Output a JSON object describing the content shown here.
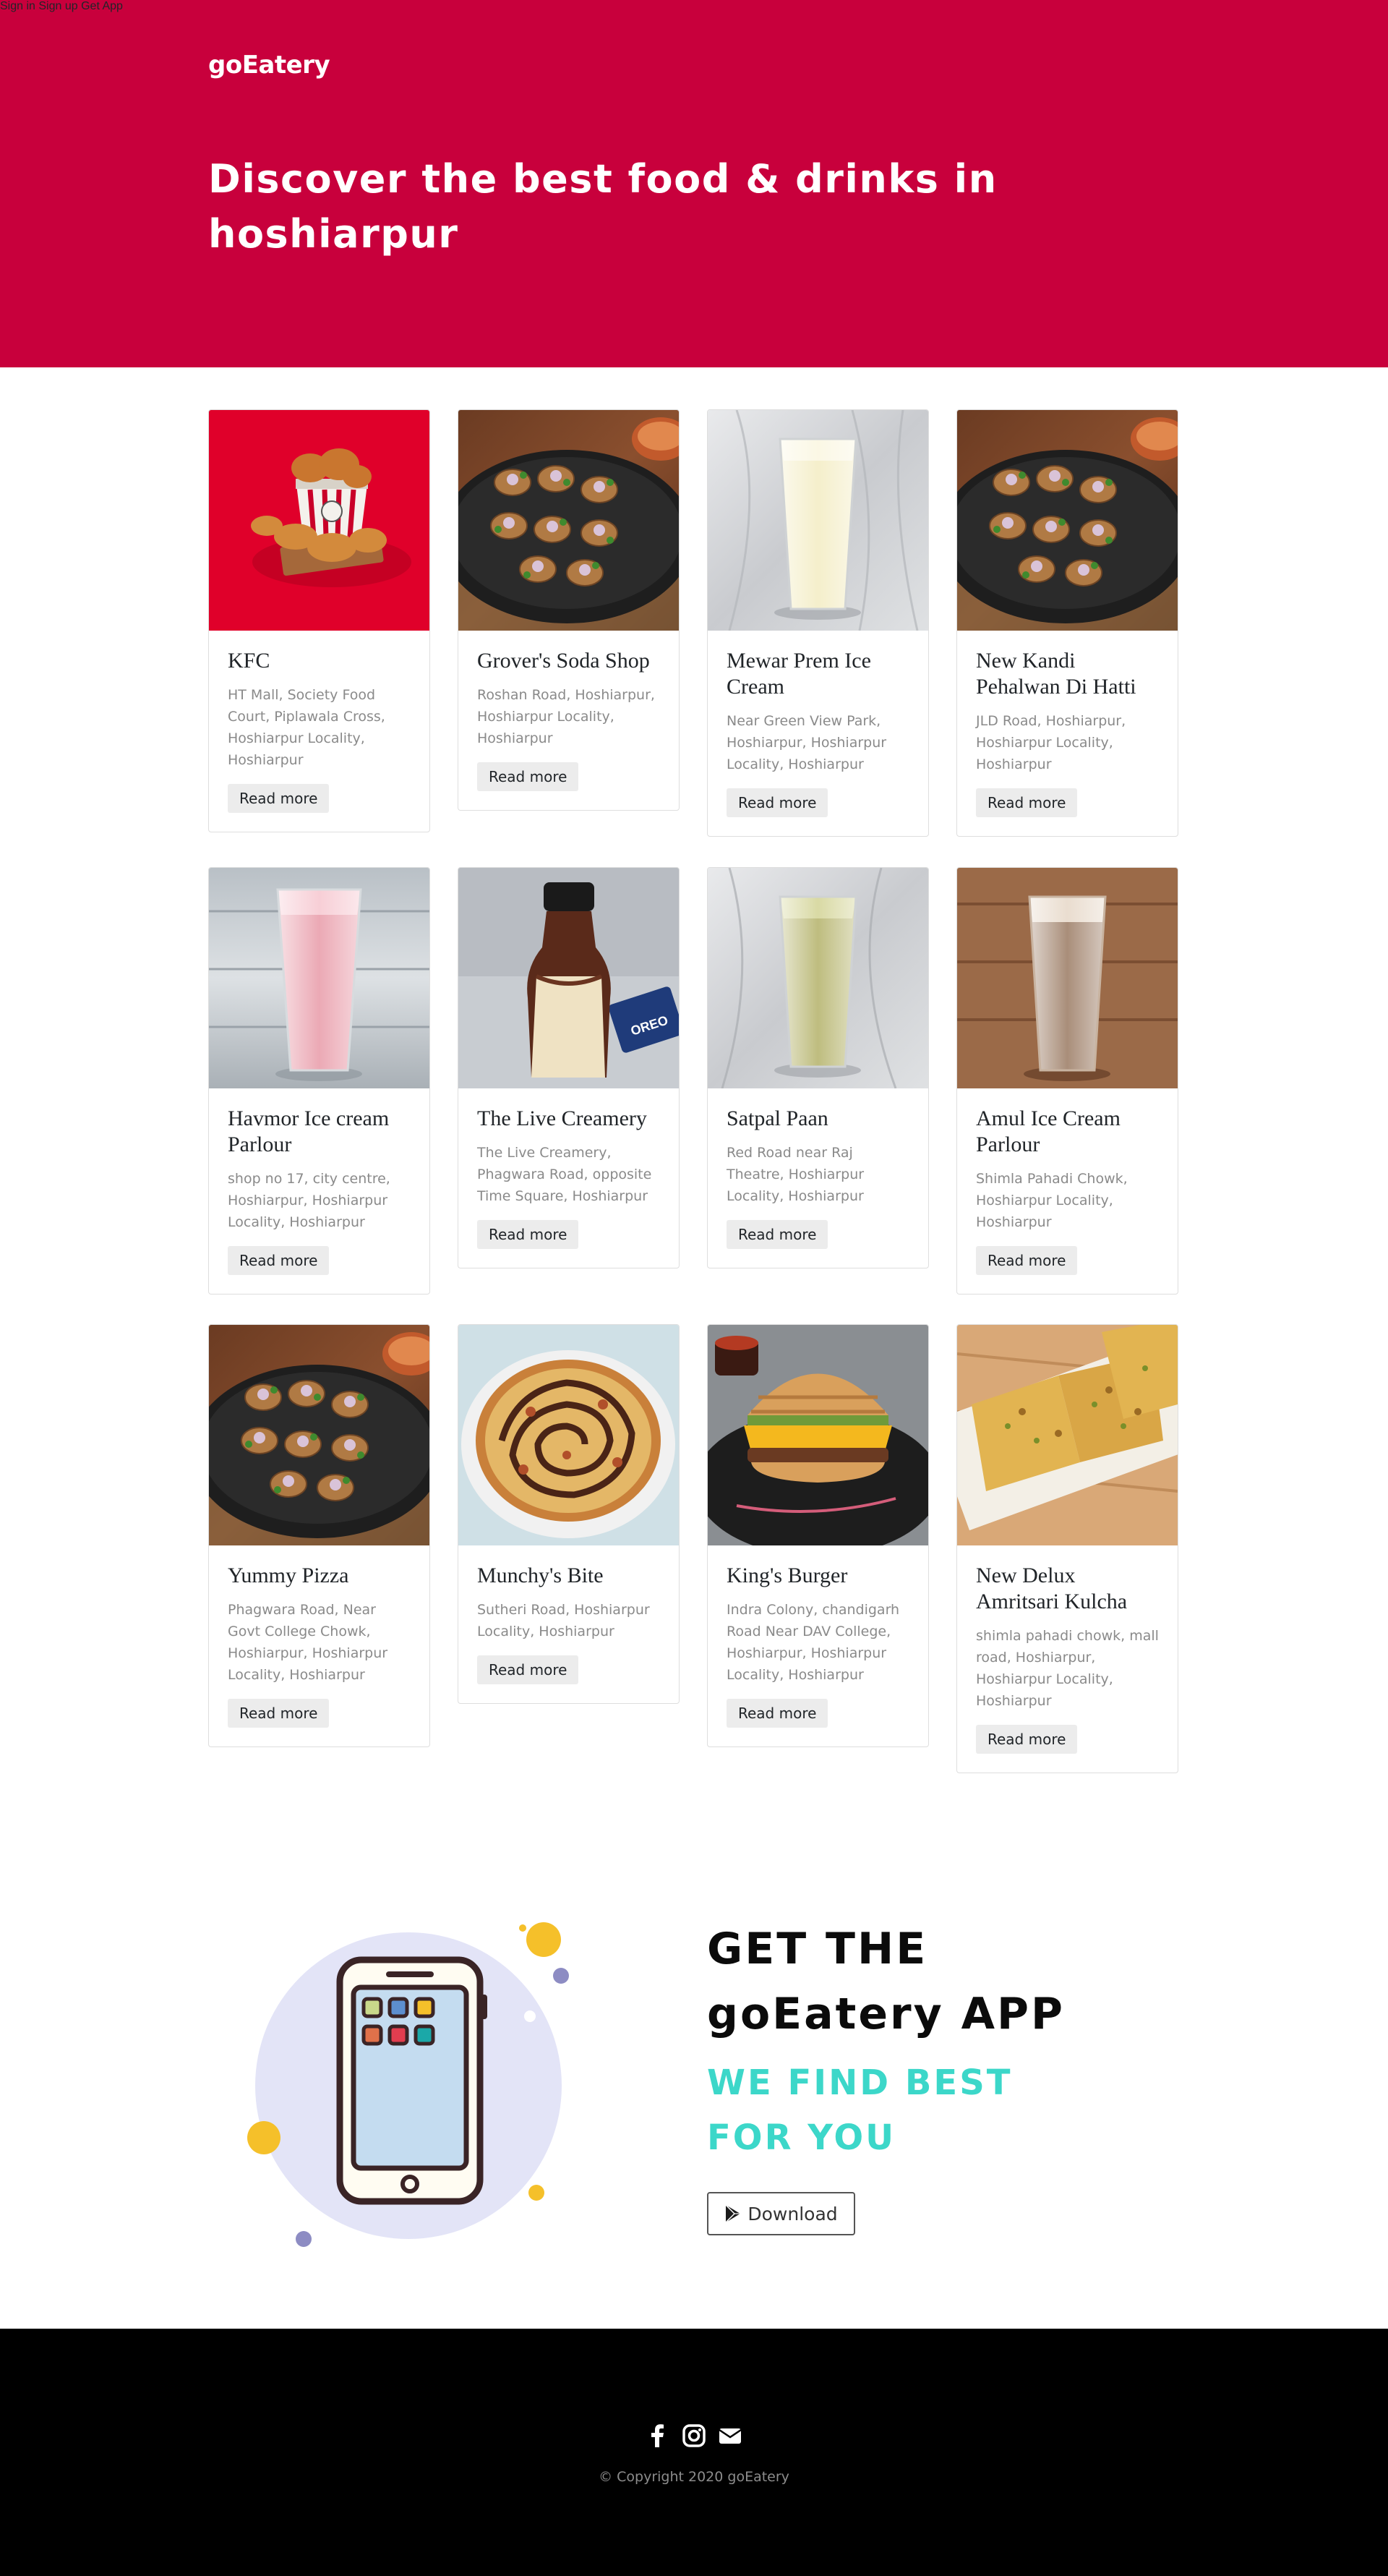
{
  "header": {
    "brand": "goEatery",
    "nav": [
      "Sign in",
      "Sign up",
      "Get App"
    ],
    "title": "Discover the best food & drinks in hoshiarpur",
    "bg_color": "#c8003c"
  },
  "restaurants": [
    {
      "name": "KFC",
      "address": "HT Mall, Society Food Court, Piplawala Cross, Hoshiarpur Locality, Hoshiarpur",
      "image": "fried-chicken-bucket-image"
    },
    {
      "name": "Grover's Soda Shop",
      "address": "Roshan Road, Hoshiarpur, Hoshiarpur Locality, Hoshiarpur",
      "image": "chaat-plate-image"
    },
    {
      "name": "Mewar Prem Ice Cream",
      "address": "Near Green View Park, Hoshiarpur, Hoshiarpur Locality, Hoshiarpur",
      "image": "vanilla-shake-image"
    },
    {
      "name": "New Kandi Pehalwan Di Hatti",
      "address": "JLD Road, Hoshiarpur, Hoshiarpur Locality, Hoshiarpur",
      "image": "chaat-plate-image"
    },
    {
      "name": "Havmor Ice cream Parlour",
      "address": "shop no 17, city centre, Hoshiarpur, Hoshiarpur Locality, Hoshiarpur",
      "image": "strawberry-shake-image"
    },
    {
      "name": "The Live Creamery",
      "address": "The Live Creamery, Phagwara Road, opposite Time Square, Hoshiarpur",
      "image": "milk-bottle-image"
    },
    {
      "name": "Satpal Paan",
      "address": "Red Road near Raj Theatre, Hoshiarpur Locality, Hoshiarpur",
      "image": "paan-shake-image"
    },
    {
      "name": "Amul Ice Cream Parlour",
      "address": "Shimla Pahadi Chowk, Hoshiarpur Locality, Hoshiarpur",
      "image": "cold-coffee-image"
    },
    {
      "name": "Yummy Pizza",
      "address": "Phagwara Road, Near Govt College Chowk, Hoshiarpur, Hoshiarpur Locality, Hoshiarpur",
      "image": "chaat-plate-image"
    },
    {
      "name": "Munchy's Bite",
      "address": "Sutheri Road, Hoshiarpur Locality, Hoshiarpur",
      "image": "pizza-image"
    },
    {
      "name": "King's Burger",
      "address": "Indra Colony, chandigarh Road Near DAV College, Hoshiarpur, Hoshiarpur Locality, Hoshiarpur",
      "image": "burger-image"
    },
    {
      "name": "New Delux Amritsari Kulcha",
      "address": "shimla pahadi chowk, mall road, Hoshiarpur, Hoshiarpur Locality, Hoshiarpur",
      "image": "kulcha-image"
    }
  ],
  "read_more_label": "Read more",
  "app_section": {
    "title_line1": "GET THE",
    "title_line2": "goEatery APP",
    "subtitle_line1": "WE FIND BEST",
    "subtitle_line2": "FOR YOU",
    "download_label": "Download",
    "accent_color": "#3cd7c9"
  },
  "footer": {
    "social_icons": [
      "facebook-icon",
      "instagram-icon",
      "envelope-icon"
    ],
    "copyright": "© Copyright 2020 goEatery"
  }
}
